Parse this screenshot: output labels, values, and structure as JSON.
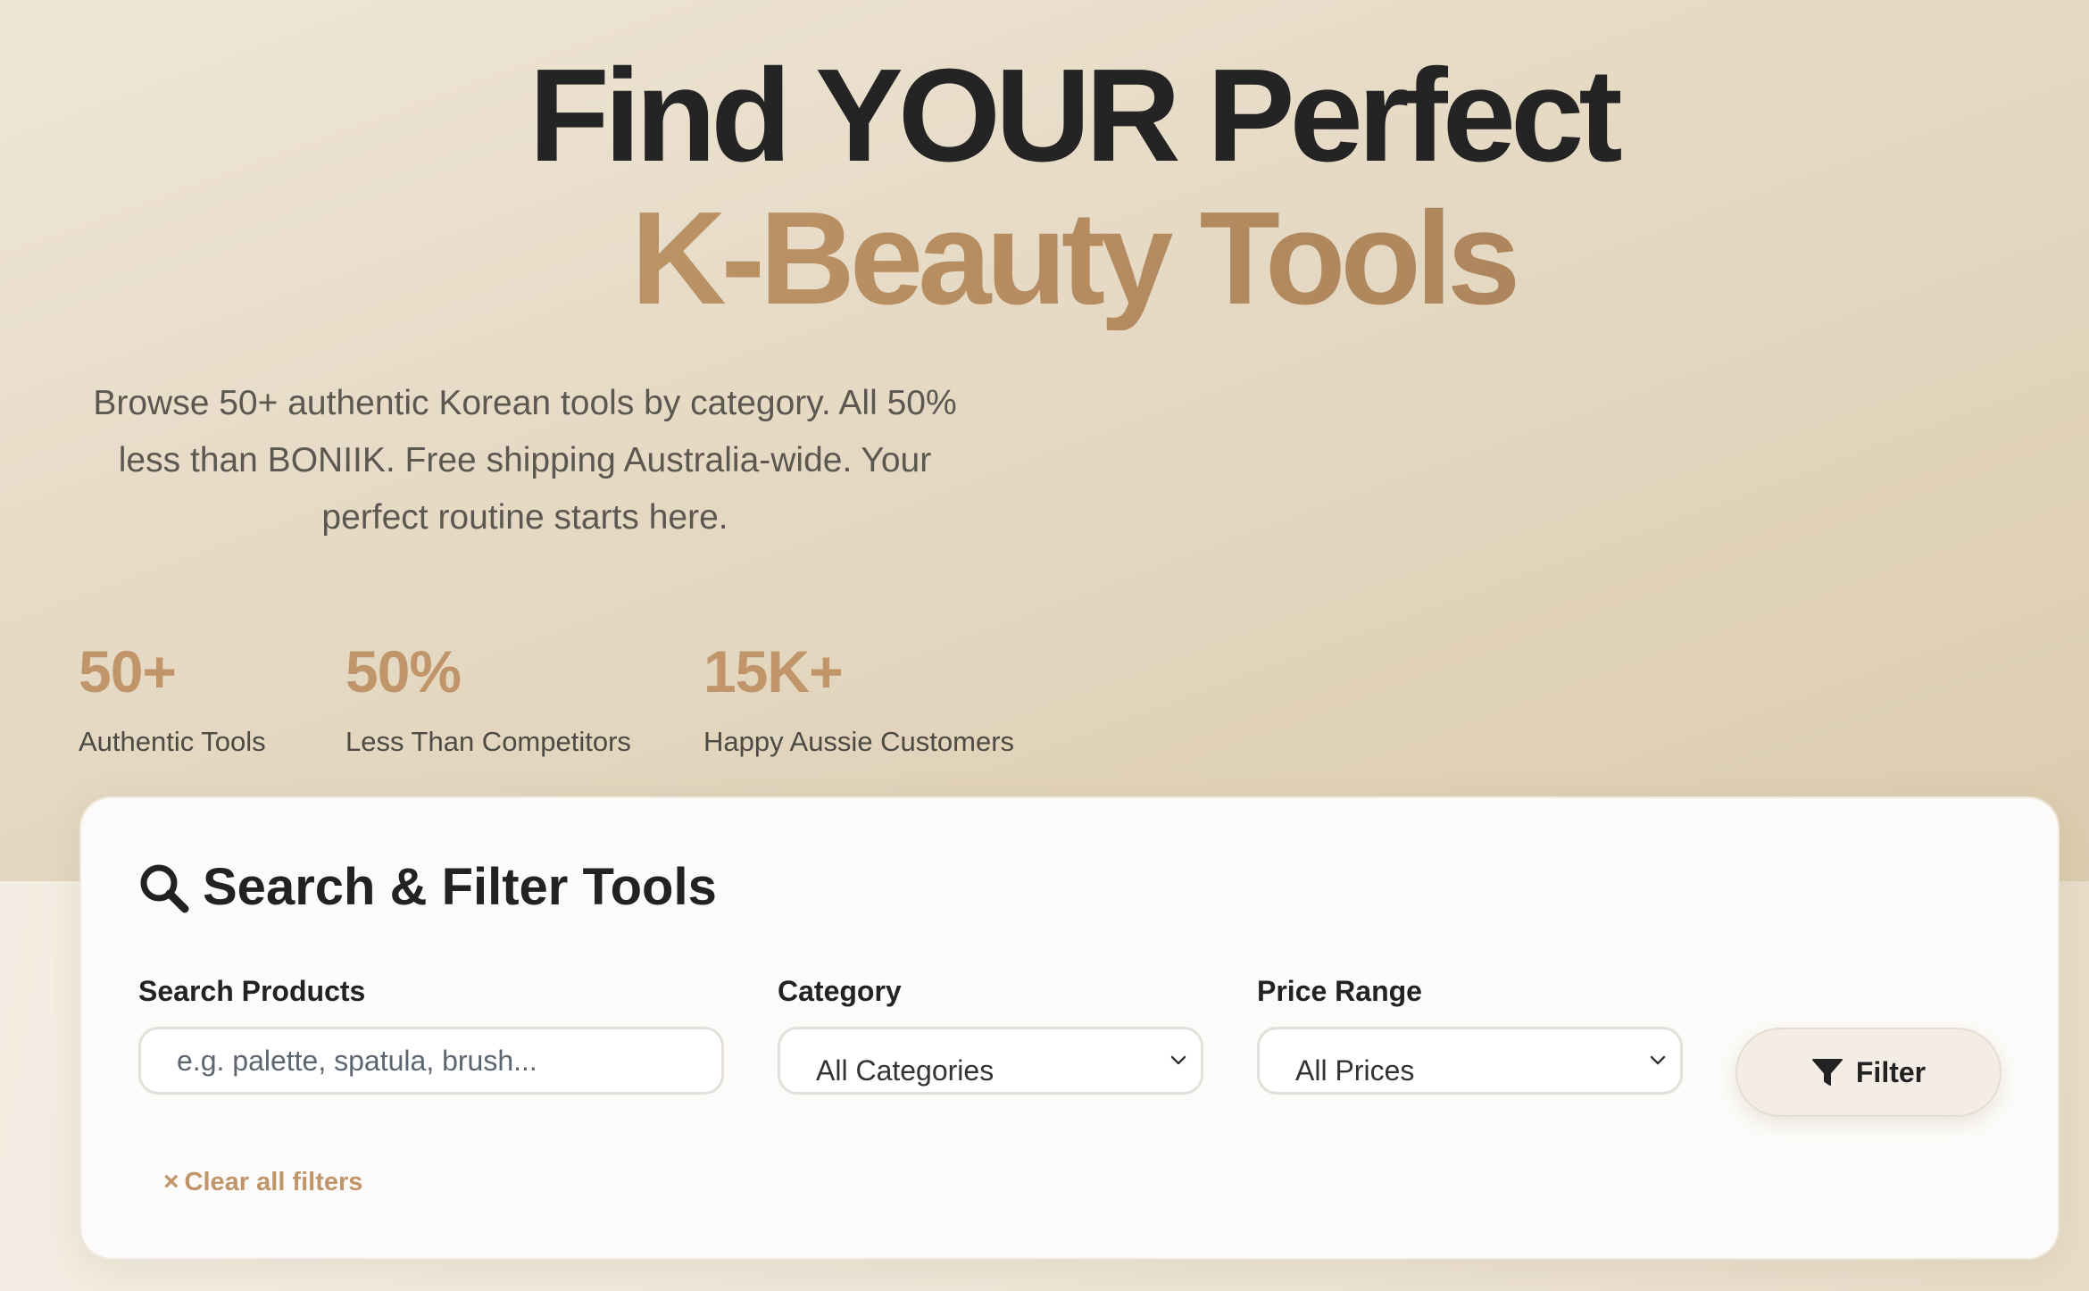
{
  "hero": {
    "title_line1": "Find YOUR Perfect",
    "title_line2": "K-Beauty Tools",
    "subtitle": "Browse 50+ authentic Korean tools by category. All 50% less than BONIIK. Free shipping Australia-wide. Your perfect routine starts here."
  },
  "stats": [
    {
      "value": "50+",
      "label": "Authentic Tools"
    },
    {
      "value": "50%",
      "label": "Less Than Competitors"
    },
    {
      "value": "15K+",
      "label": "Happy Aussie Customers"
    }
  ],
  "filter_panel": {
    "title": "Search & Filter Tools",
    "title_icon": "search-icon",
    "search": {
      "label": "Search Products",
      "placeholder": "e.g. palette, spatula, brush...",
      "value": ""
    },
    "category": {
      "label": "Category",
      "selected": "All Categories"
    },
    "price_range": {
      "label": "Price Range",
      "selected": "All Prices"
    },
    "filter_button": {
      "label": "Filter",
      "icon": "funnel-icon"
    },
    "clear_filters": {
      "icon": "×",
      "label": "Clear all filters"
    }
  },
  "colors": {
    "accent": "#c0956a",
    "accent_dark": "#a57d57",
    "heading": "#242424",
    "card_background": "#fcfbf9"
  }
}
